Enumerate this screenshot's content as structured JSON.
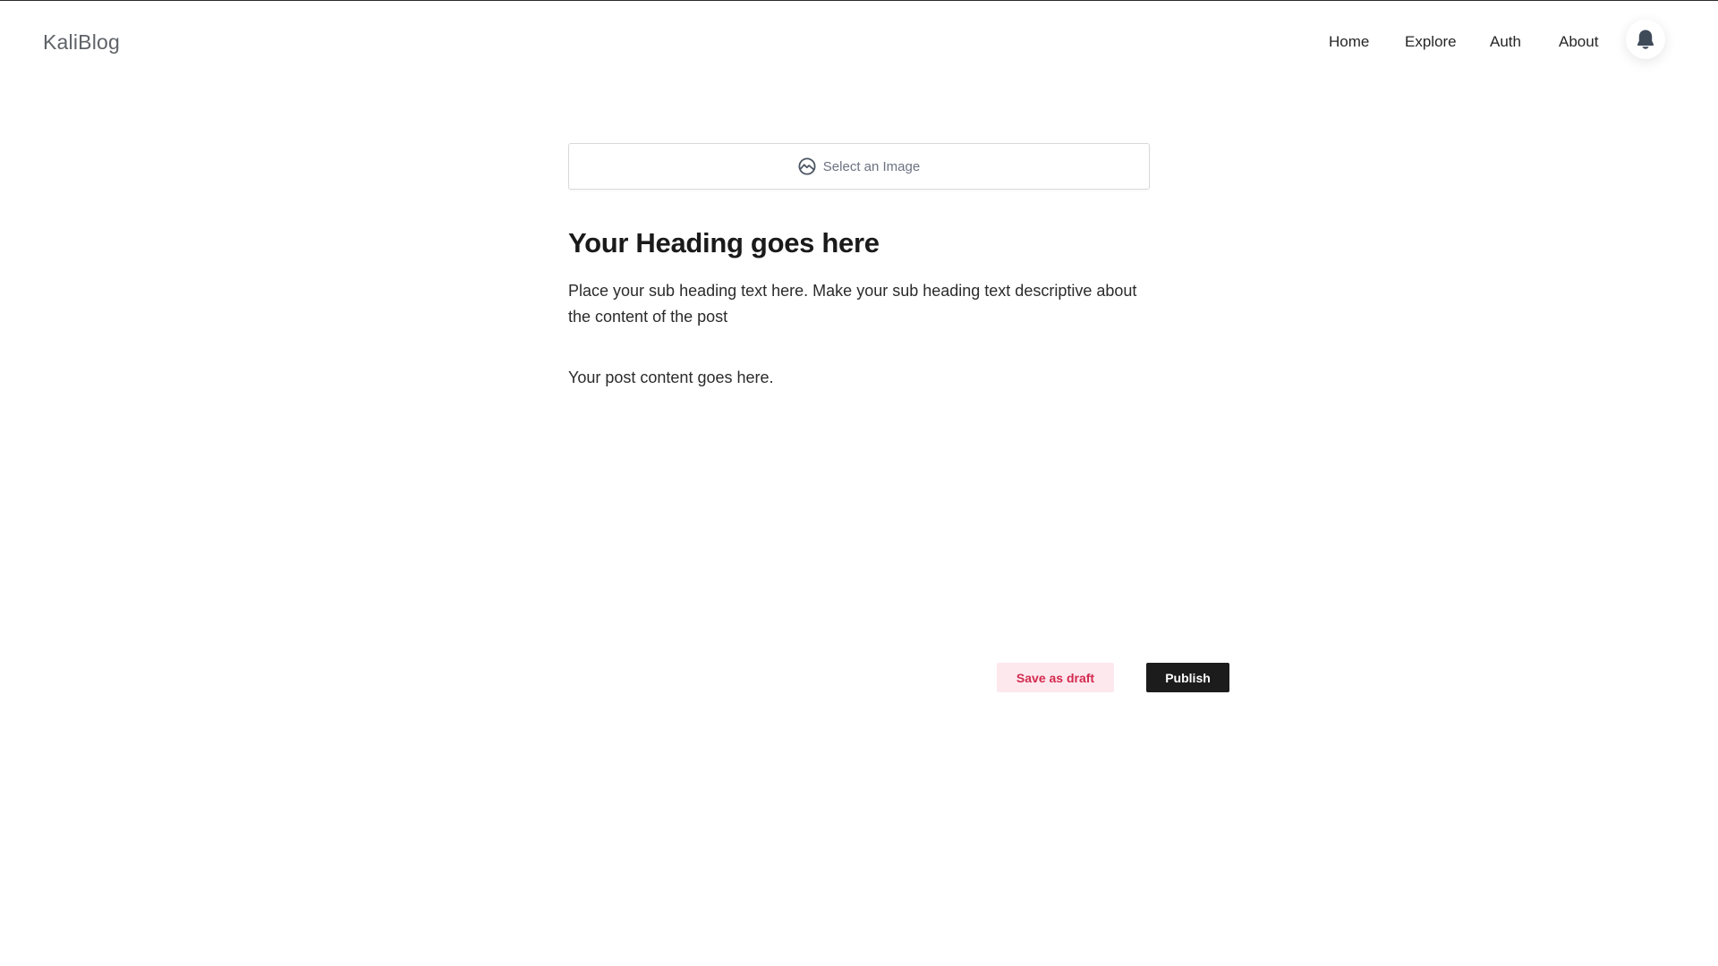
{
  "navbar": {
    "brand": "KaliBlog",
    "links": [
      {
        "label": "Home"
      },
      {
        "label": "Explore"
      },
      {
        "label": "Auth"
      },
      {
        "label": "About"
      }
    ],
    "avatar_icon": "user-icon"
  },
  "editor": {
    "image_picker": {
      "label": "Select an Image",
      "icon": "image-icon"
    },
    "heading": "Your Heading goes here",
    "subheading": "Place your sub heading text here. Make your sub heading text descriptive about the content of the post",
    "content": "Your post content goes here."
  },
  "actions": {
    "save_draft_label": "Save as draft",
    "publish_label": "Publish"
  },
  "colors": {
    "draft_bg": "#fde8ee",
    "draft_text": "#d32a4e",
    "publish_bg": "#1c1c1c",
    "publish_text": "#ffffff"
  }
}
